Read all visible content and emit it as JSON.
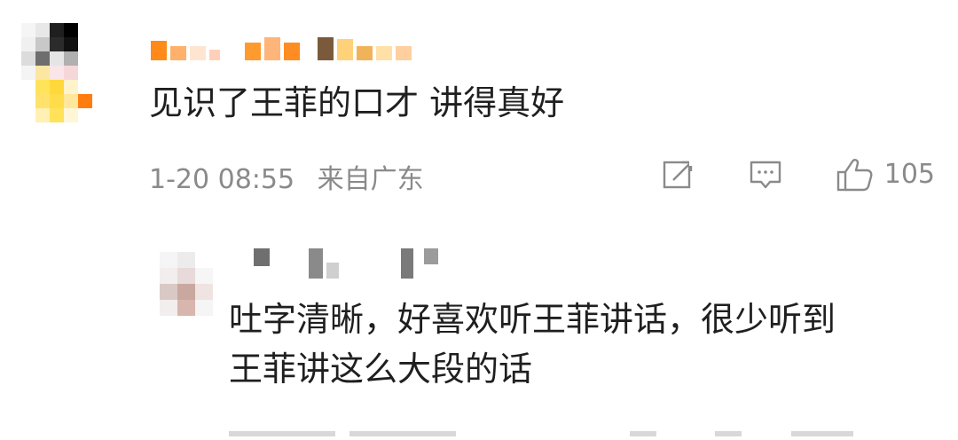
{
  "comment": {
    "text": "见识了王菲的口才 讲得真好",
    "timestamp": "1-20 08:55",
    "location": "来自广东",
    "like_count": "105",
    "icons": {
      "share": "share-icon",
      "comment": "comment-icon",
      "like": "thumbs-up-icon"
    },
    "colors": {
      "text": "#1f1f1f",
      "meta": "#8a8a8a"
    }
  },
  "reply": {
    "line1": "吐字清晰，好喜欢听王菲讲话，很少听到",
    "line2": "王菲讲这么大段的话"
  }
}
